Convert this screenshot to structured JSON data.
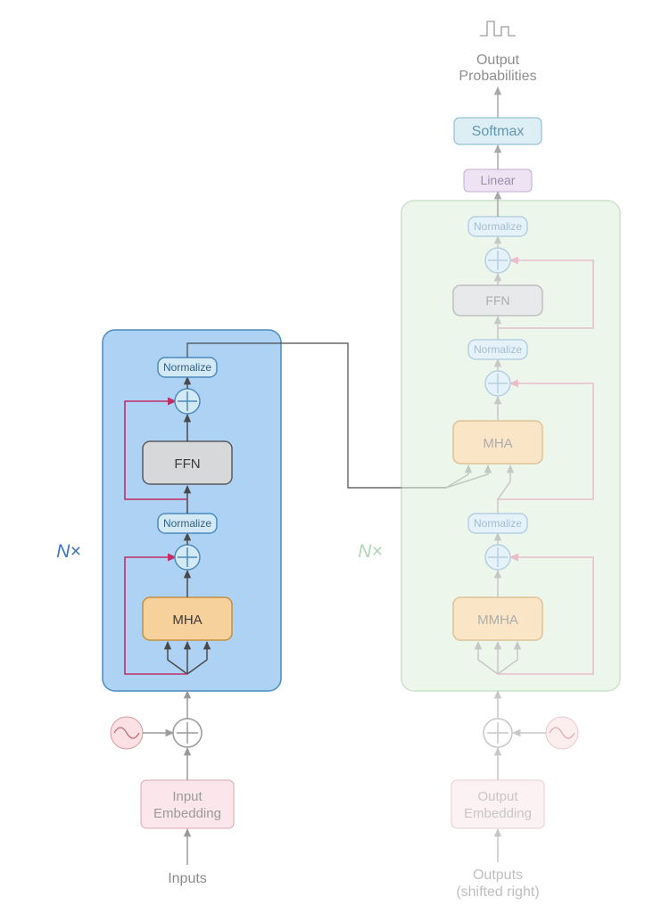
{
  "encoder": {
    "repeat_label": "N×",
    "input_label": "Inputs",
    "embedding_label_line1": "Input",
    "embedding_label_line2": "Embedding",
    "mha_label": "MHA",
    "norm1_label": "Normalize",
    "ffn_label": "FFN",
    "norm2_label": "Normalize"
  },
  "decoder": {
    "repeat_label": "N×",
    "output_label_line1": "Outputs",
    "output_label_line2": "(shifted right)",
    "embedding_label_line1": "Output",
    "embedding_label_line2": "Embedding",
    "mmha_label": "MMHA",
    "norm1_label": "Normalize",
    "mha_label": "MHA",
    "norm2_label": "Normalize",
    "ffn_label": "FFN",
    "norm3_label": "Normalize"
  },
  "head": {
    "linear_label": "Linear",
    "softmax_label": "Softmax",
    "output_label_line1": "Output",
    "output_label_line2": "Probabilities"
  },
  "colors": {
    "encoder_block_fill": "#aed2f4",
    "encoder_block_stroke": "#4b8bbd",
    "decoder_block_fill": "#dff0dc",
    "decoder_block_stroke": "#9fc9a0",
    "embedding_fill": "#fbe6eb",
    "embedding_stroke": "#d9a8b0",
    "mha_fill": "#f7d19b",
    "mha_stroke": "#c58f3e",
    "ffn_fill": "#d7d8da",
    "ffn_stroke": "#5a5b5d",
    "norm_fill": "#d3e9f6",
    "norm_stroke": "#4b8bbd",
    "softmax_fill": "#d8ecf4",
    "softmax_stroke": "#6aa8c5",
    "linear_fill": "#eadff0",
    "linear_stroke": "#b99fc8",
    "arrow": "#4a4a4a",
    "residual": "#c02d65",
    "pe_fill": "#fbe1e3",
    "pe_stroke": "#d99aa1",
    "text_muted": "#8a8a8a",
    "repeat_enc": "#3b77b5",
    "repeat_dec": "#6fb576"
  }
}
